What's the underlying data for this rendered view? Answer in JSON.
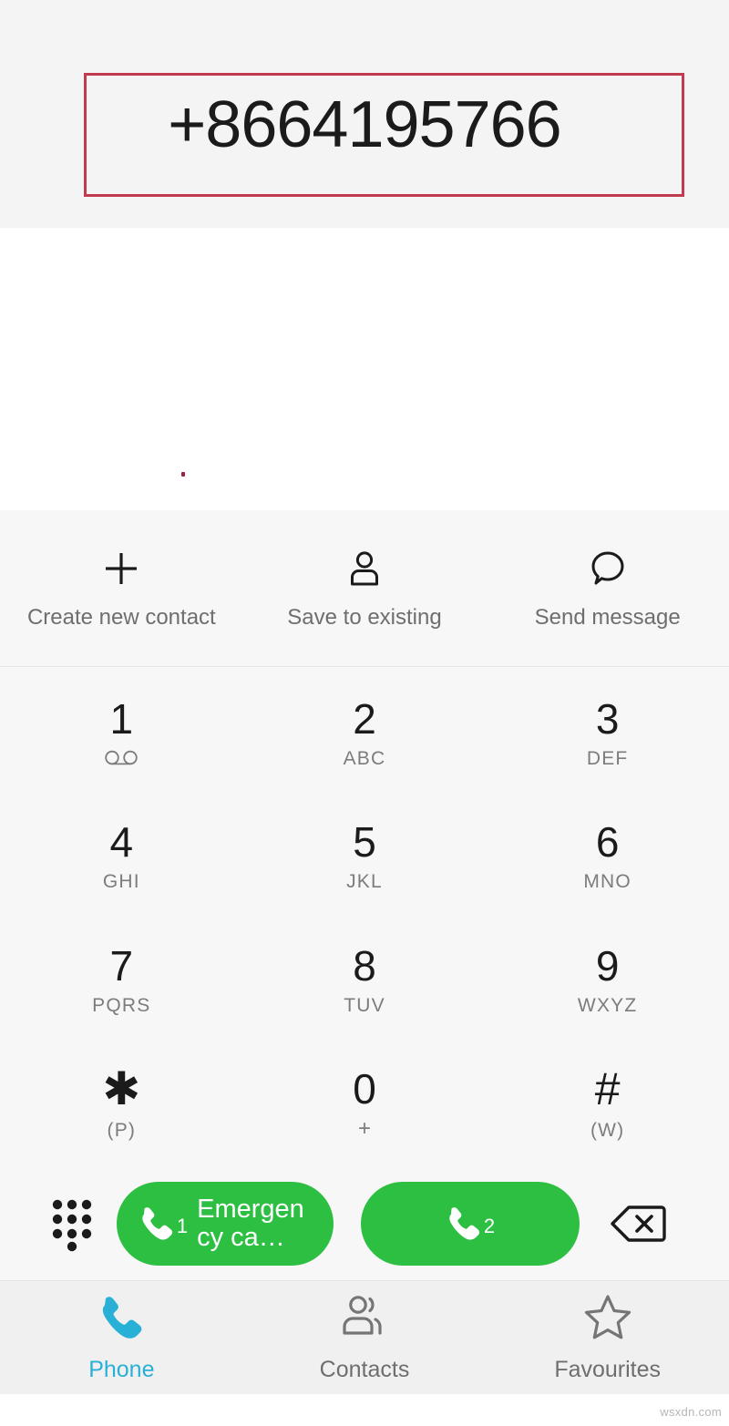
{
  "display": {
    "number": "+8664195766",
    "annotation_color": "#c23a4d"
  },
  "actions": [
    {
      "label": "Create new contact",
      "icon": "plus-icon"
    },
    {
      "label": "Save to existing",
      "icon": "person-icon"
    },
    {
      "label": "Send message",
      "icon": "speech-bubble-icon"
    }
  ],
  "dialpad": {
    "keys": [
      {
        "digit": "1",
        "sub": "",
        "icon": "voicemail-icon"
      },
      {
        "digit": "2",
        "sub": "ABC",
        "icon": ""
      },
      {
        "digit": "3",
        "sub": "DEF",
        "icon": ""
      },
      {
        "digit": "4",
        "sub": "GHI",
        "icon": ""
      },
      {
        "digit": "5",
        "sub": "JKL",
        "icon": ""
      },
      {
        "digit": "6",
        "sub": "MNO",
        "icon": ""
      },
      {
        "digit": "7",
        "sub": "PQRS",
        "icon": ""
      },
      {
        "digit": "8",
        "sub": "TUV",
        "icon": ""
      },
      {
        "digit": "9",
        "sub": "WXYZ",
        "icon": ""
      },
      {
        "digit": "✱",
        "sub": "(P)",
        "icon": ""
      },
      {
        "digit": "0",
        "sub": "+",
        "icon": ""
      },
      {
        "digit": "#",
        "sub": "(W)",
        "icon": ""
      }
    ]
  },
  "call_row": {
    "pad_toggle_icon": "dialpad-grid-icon",
    "sim1": {
      "badge": "1",
      "label": "Emergency ca…",
      "color": "#2dbf42"
    },
    "sim2": {
      "badge": "2",
      "label": "",
      "color": "#2dbf42"
    },
    "backspace_icon": "backspace-icon"
  },
  "bottom_nav": {
    "active_color": "#29b0d6",
    "items": [
      {
        "label": "Phone",
        "icon": "phone-icon",
        "active": true
      },
      {
        "label": "Contacts",
        "icon": "contacts-icon",
        "active": false
      },
      {
        "label": "Favourites",
        "icon": "star-icon",
        "active": false
      }
    ]
  },
  "watermark": "wsxdn.com"
}
